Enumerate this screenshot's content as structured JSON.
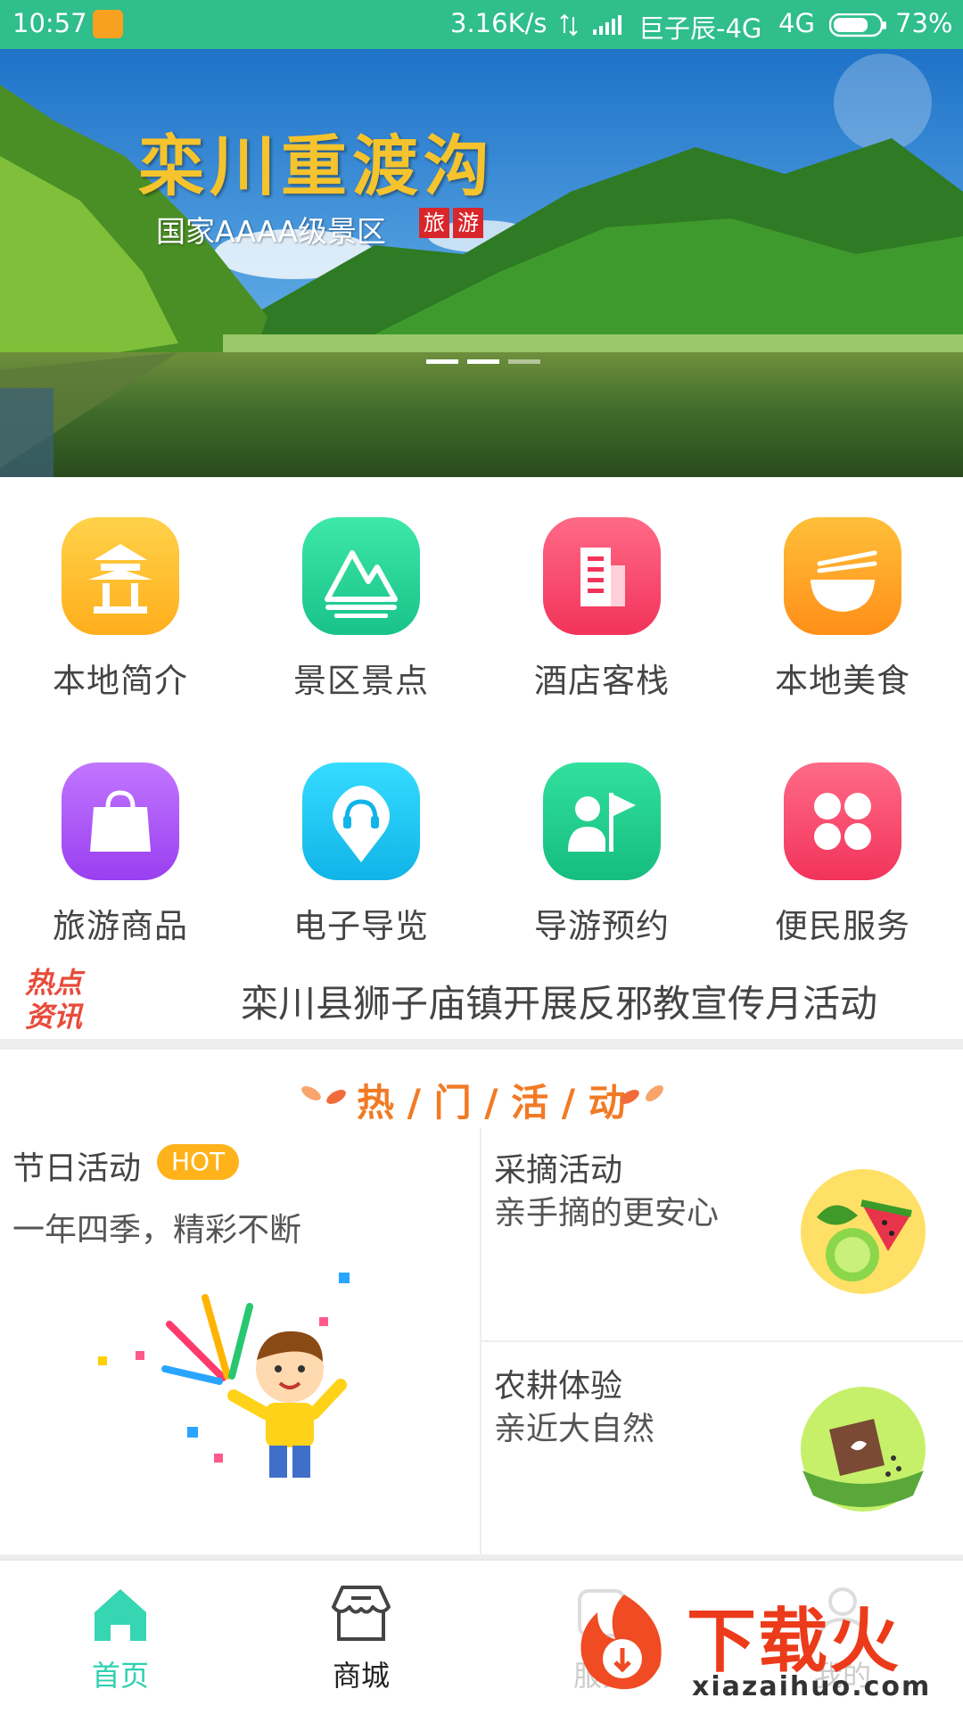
{
  "status_bar": {
    "time": "10:57",
    "net_speed": "3.16K/s",
    "carrier": "巨子辰-4G",
    "network": "4G",
    "battery": "73%"
  },
  "banner": {
    "title": "栾川重渡沟",
    "subtitle": "国家AAAA级景区",
    "tag_1": "旅",
    "tag_2": "游",
    "page_index": 2,
    "page_count": 3
  },
  "grid": [
    {
      "label": "本地简介",
      "icon": "pavilion-icon",
      "color": "#ffbe24"
    },
    {
      "label": "景区景点",
      "icon": "mountain-icon",
      "color": "#2fd89a"
    },
    {
      "label": "酒店客栈",
      "icon": "building-icon",
      "color": "#ff4d6e"
    },
    {
      "label": "本地美食",
      "icon": "bowl-icon",
      "color": "#ffa726"
    },
    {
      "label": "旅游商品",
      "icon": "shopping-bag-icon",
      "color": "#a855f0"
    },
    {
      "label": "电子导览",
      "icon": "audio-guide-pin-icon",
      "color": "#1ec8f0"
    },
    {
      "label": "导游预约",
      "icon": "guide-flag-icon",
      "color": "#1fcf8e"
    },
    {
      "label": "便民服务",
      "icon": "clover-icon",
      "color": "#ff4f6e"
    }
  ],
  "news": {
    "badge_line1": "热点",
    "badge_line2": "资讯",
    "text": "栾川县狮子庙镇开展反邪教宣传月活动"
  },
  "hot": {
    "title": "热 / 门 / 活 / 动",
    "festival": {
      "title": "节日活动",
      "badge": "HOT",
      "subtitle": "一年四季，精彩不断"
    },
    "picking": {
      "title": "采摘活动",
      "subtitle": "亲手摘的更安心"
    },
    "farming": {
      "title": "农耕体验",
      "subtitle": "亲近大自然"
    }
  },
  "tabbar": [
    {
      "label": "首页",
      "icon": "home-icon",
      "active": true
    },
    {
      "label": "商城",
      "icon": "store-icon",
      "active": false
    },
    {
      "label": "服务",
      "icon": "service-icon",
      "active": false
    },
    {
      "label": "我的",
      "icon": "profile-icon",
      "active": false
    }
  ],
  "watermark": {
    "text": "下载火",
    "url": "xiazaihuo.com"
  }
}
